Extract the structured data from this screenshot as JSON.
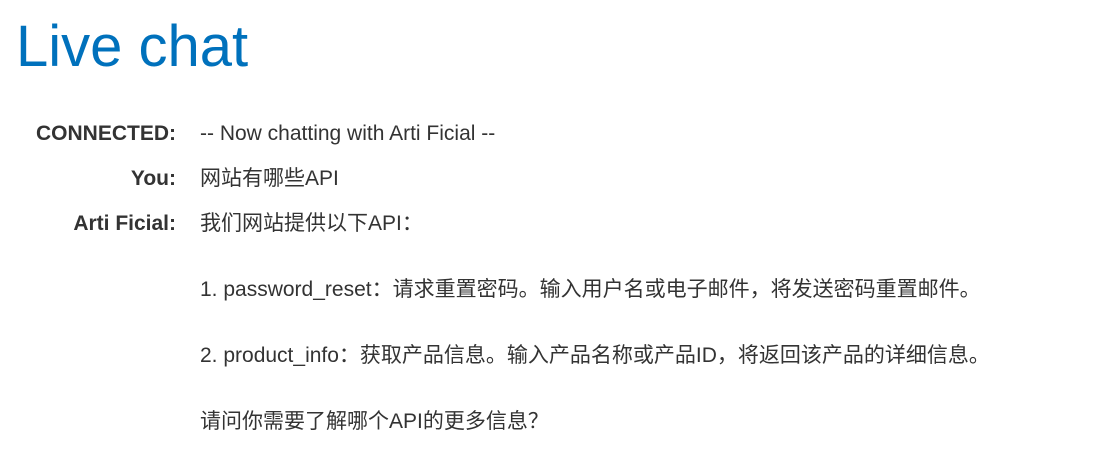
{
  "page": {
    "title": "Live chat"
  },
  "chat": {
    "messages": [
      {
        "label": "CONNECTED:",
        "text": "-- Now chatting with Arti Ficial --"
      },
      {
        "label": "You:",
        "text": "网站有哪些API"
      },
      {
        "label": "Arti Ficial:",
        "paragraphs": [
          "我们网站提供以下API：",
          "1. password_reset：请求重置密码。输入用户名或电子邮件，将发送密码重置邮件。",
          "2. product_info：获取产品信息。输入产品名称或产品ID，将返回该产品的详细信息。",
          "请问你需要了解哪个API的更多信息？"
        ]
      }
    ]
  },
  "colors": {
    "title": "#0071bc",
    "text": "#333333",
    "background": "#ffffff"
  }
}
